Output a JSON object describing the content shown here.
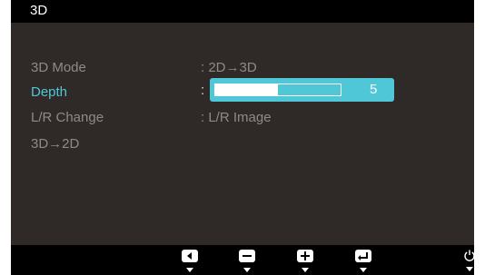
{
  "osd": {
    "title": "3D",
    "items": [
      {
        "label": "3D Mode",
        "value": ": 2D→3D",
        "active": false
      },
      {
        "label": "Depth",
        "value": ":",
        "active": true
      },
      {
        "label": "L/R Change",
        "value": ": L/R Image",
        "active": false
      },
      {
        "label": "3D→2D",
        "value": "",
        "active": false
      }
    ],
    "depth_slider": {
      "value": "5",
      "level_fraction": 0.5
    }
  },
  "buttons": [
    {
      "icon": "left-arrow-icon"
    },
    {
      "icon": "minus-icon"
    },
    {
      "icon": "plus-icon"
    },
    {
      "icon": "enter-icon"
    },
    {
      "icon": "power-icon"
    }
  ],
  "colors": {
    "accent": "#4fc7d6",
    "background": "#2f2a28",
    "bar": "#000000"
  }
}
